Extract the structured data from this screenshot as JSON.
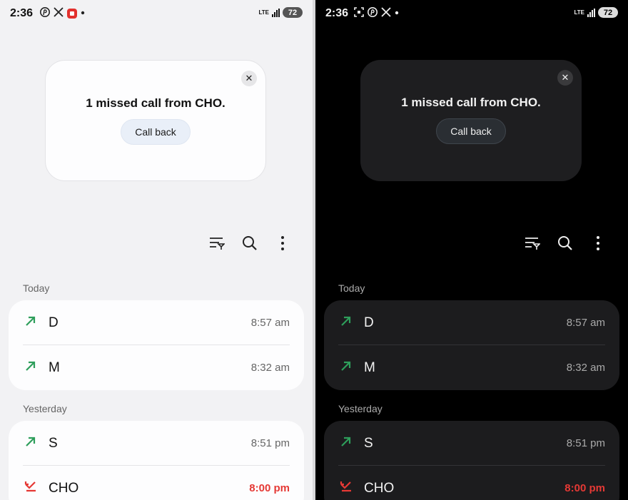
{
  "light": {
    "status": {
      "time": "2:36",
      "lte": "LTE",
      "battery": "72"
    },
    "missed_card": {
      "text": "1 missed call from CHO.",
      "button": "Call back"
    },
    "sections": [
      {
        "label": "Today",
        "calls": [
          {
            "name": "D",
            "time": "8:57 am",
            "type": "outgoing"
          },
          {
            "name": "M",
            "time": "8:32 am",
            "type": "outgoing"
          }
        ]
      },
      {
        "label": "Yesterday",
        "calls": [
          {
            "name": "S",
            "time": "8:51 pm",
            "type": "outgoing"
          },
          {
            "name": "CHO",
            "time": "8:00 pm",
            "type": "missed"
          }
        ]
      }
    ]
  },
  "dark": {
    "status": {
      "time": "2:36",
      "lte": "LTE",
      "battery": "72"
    },
    "missed_card": {
      "text": "1 missed call from CHO.",
      "button": "Call back"
    },
    "sections": [
      {
        "label": "Today",
        "calls": [
          {
            "name": "D",
            "time": "8:57 am",
            "type": "outgoing"
          },
          {
            "name": "M",
            "time": "8:32 am",
            "type": "outgoing"
          }
        ]
      },
      {
        "label": "Yesterday",
        "calls": [
          {
            "name": "S",
            "time": "8:51 pm",
            "type": "outgoing"
          },
          {
            "name": "CHO",
            "time": "8:00 pm",
            "type": "missed"
          }
        ]
      }
    ]
  },
  "colors": {
    "outgoing": "#2e9e5b",
    "missed": "#e53935"
  },
  "icons": [
    "pinterest-icon",
    "x-icon",
    "app-notification-icon",
    "screenshot-icon",
    "close-icon",
    "filter-icon",
    "search-icon",
    "more-options-icon",
    "outgoing-call-icon",
    "missed-call-icon"
  ]
}
